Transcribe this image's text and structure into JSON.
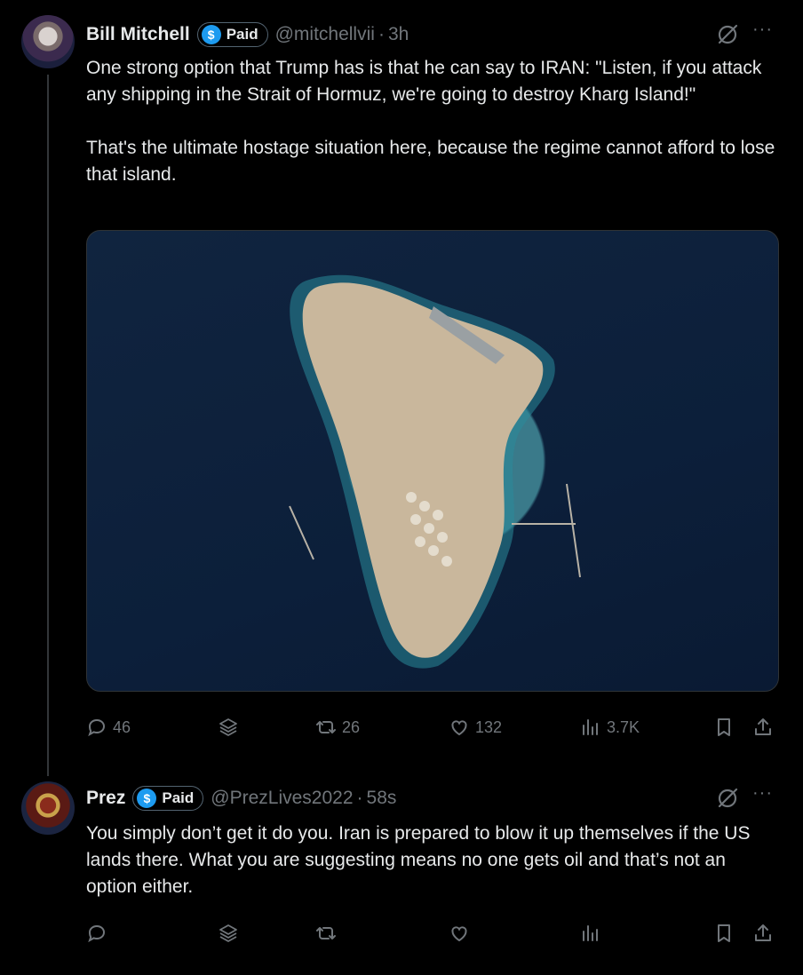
{
  "tweets": [
    {
      "name": "Bill Mitchell",
      "badge_label": "Paid",
      "handle": "@mitchellvii",
      "separator": "·",
      "time": "3h",
      "more_label": "···",
      "text": "One strong option that Trump has is that he can say to IRAN: \"Listen, if you attack any shipping in the Strait of Hormuz, we're going to destroy Kharg Island!\"\n\nThat's the ultimate hostage situation here, because the regime cannot afford to lose that island.",
      "actions": {
        "replies": "46",
        "retweets": "26",
        "likes": "132",
        "views": "3.7K"
      }
    },
    {
      "name": "Prez",
      "badge_label": "Paid",
      "handle": "@PrezLives2022",
      "separator": "·",
      "time": "58s",
      "more_label": "···",
      "text": "You simply don’t get it do you. Iran is prepared to blow it up themselves if the US lands there. What you are suggesting means no one gets oil and that’s not an option either.",
      "actions": {
        "replies": "",
        "retweets": "",
        "likes": "",
        "views": ""
      }
    }
  ],
  "colors": {
    "background": "#000000",
    "text": "#e7e9ea",
    "muted": "#71767b",
    "verified_blue": "#1d9bf0",
    "divider": "#333639"
  },
  "icons": [
    "reply-icon",
    "grok-stack-icon",
    "retweet-icon",
    "like-icon",
    "views-icon",
    "bookmark-icon",
    "share-icon",
    "grok-icon",
    "more-icon",
    "dollar-badge-icon"
  ]
}
